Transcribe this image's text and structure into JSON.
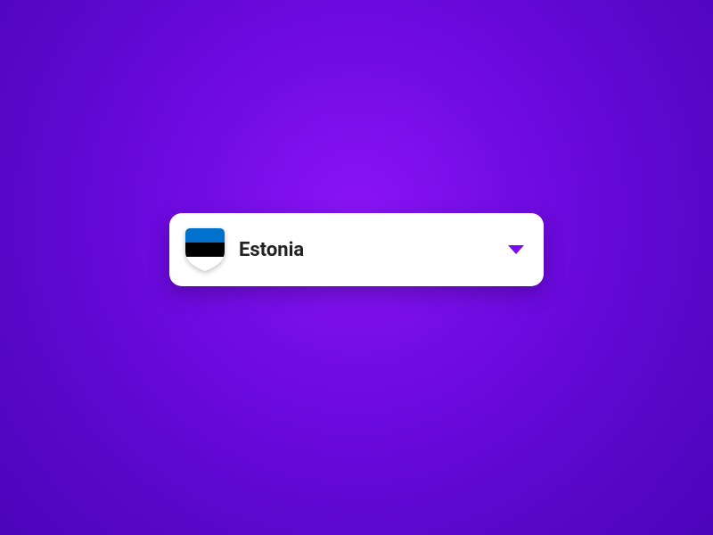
{
  "dropdown": {
    "selected_label": "Estonia",
    "flag": {
      "name": "estonia-flag-icon",
      "stripes": [
        "#0072ce",
        "#000000",
        "#ffffff"
      ]
    },
    "caret_color": "#7a0af0"
  },
  "colors": {
    "background_center": "#8a14f5",
    "background_edge": "#4c05ba",
    "card_background": "#ffffff",
    "text": "#222222"
  }
}
